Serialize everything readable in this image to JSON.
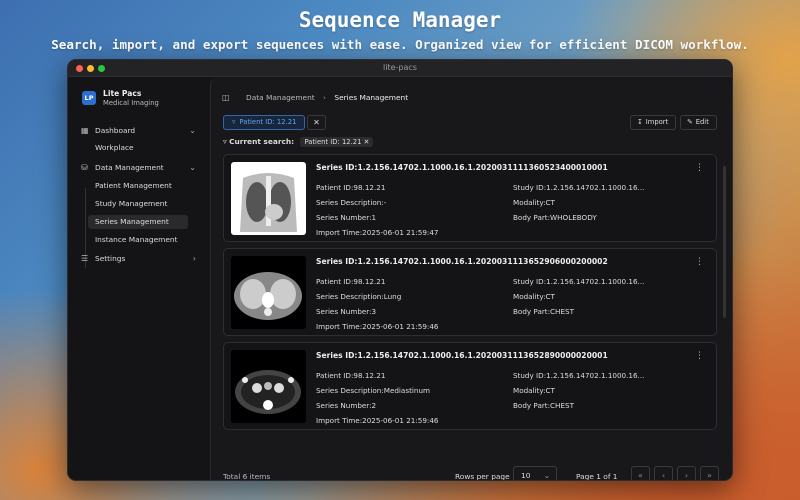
{
  "hero": {
    "title": "Sequence Manager",
    "subtitle": "Search, import, and export sequences with ease. Organized view for efficient DICOM workflow."
  },
  "window": {
    "title": "lite-pacs"
  },
  "brand": {
    "logo": "LP",
    "name": "Lite Pacs",
    "subtitle": "Medical Imaging"
  },
  "sidebar": {
    "dashboard": "Dashboard",
    "workplace": "Workplace",
    "data_management": "Data Management",
    "items": [
      "Patient Management",
      "Study Management",
      "Series Management",
      "Instance Management"
    ],
    "settings": "Settings"
  },
  "breadcrumb": {
    "parent": "Data Management",
    "current": "Series Management"
  },
  "filter": {
    "chip": "Patient ID: 12.21",
    "current_label": "Current search:",
    "current_value": "Patient ID: 12.21"
  },
  "toolbar": {
    "import": "Import",
    "edit": "Edit"
  },
  "series": [
    {
      "series_id": "Series ID:1.2.156.14702.1.1000.16.1.2020031111360523400010001",
      "patient_id": "Patient ID:98.12.21",
      "study_id": "Study ID:1.2.156.14702.1.1000.16...",
      "description": "Series Description:-",
      "modality": "Modality:CT",
      "number": "Series Number:1",
      "body_part": "Body Part:WHOLEBODY",
      "import_time": "Import Time:2025-06-01 21:59:47"
    },
    {
      "series_id": "Series ID:1.2.156.14702.1.1000.16.1.2020031113652906000200002",
      "patient_id": "Patient ID:98.12.21",
      "study_id": "Study ID:1.2.156.14702.1.1000.16...",
      "description": "Series Description:Lung",
      "modality": "Modality:CT",
      "number": "Series Number:3",
      "body_part": "Body Part:CHEST",
      "import_time": "Import Time:2025-06-01 21:59:46"
    },
    {
      "series_id": "Series ID:1.2.156.14702.1.1000.16.1.2020031113652890000020001",
      "patient_id": "Patient ID:98.12.21",
      "study_id": "Study ID:1.2.156.14702.1.1000.16...",
      "description": "Series Description:Mediastinum",
      "modality": "Modality:CT",
      "number": "Series Number:2",
      "body_part": "Body Part:CHEST",
      "import_time": "Import Time:2025-06-01 21:59:46"
    }
  ],
  "footer": {
    "total": "Total 6 items",
    "rows_label": "Rows per page",
    "rows_value": "10",
    "page": "Page 1 of 1"
  }
}
